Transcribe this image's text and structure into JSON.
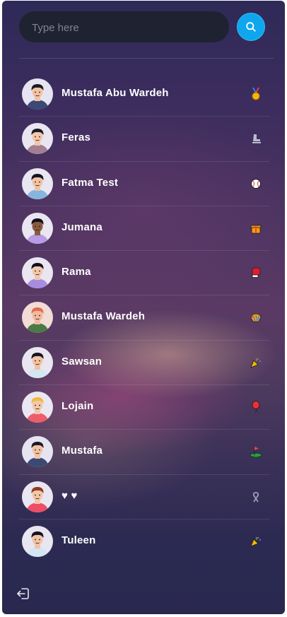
{
  "search": {
    "placeholder": "Type here",
    "button_icon": "search-icon"
  },
  "contacts": [
    {
      "name": "Mustafa Abu Wardeh",
      "avatar_bg": "#e7e4f2",
      "skin": "#f2c3a3",
      "hair": "#1c1a24",
      "shirt": "#3b4a74",
      "badge_icon": "medal-icon"
    },
    {
      "name": "Feras",
      "avatar_bg": "#e9e6f1",
      "skin": "#f3c6a8",
      "hair": "#1c1a24",
      "shirt": "#a47f91",
      "badge_icon": "ice-skate-icon"
    },
    {
      "name": "Fatma Test",
      "avatar_bg": "#e9e6f1",
      "skin": "#f1c3a3",
      "hair": "#151320",
      "shirt": "#86b5e0",
      "badge_icon": "baseball-icon"
    },
    {
      "name": "Jumana",
      "avatar_bg": "#e9e6f1",
      "skin": "#8a5a3e",
      "hair": "#111018",
      "shirt": "#b89ae6",
      "badge_icon": "gift-icon"
    },
    {
      "name": "Rama",
      "avatar_bg": "#e9e6f1",
      "skin": "#f2c8ad",
      "hair": "#111018",
      "shirt": "#a98be0",
      "badge_icon": "boxing-glove-icon"
    },
    {
      "name": "Mustafa Wardeh",
      "avatar_bg": "#f1dcd6",
      "skin": "#f2b9a0",
      "hair": "#e46b4c",
      "shirt": "#4b7a45",
      "badge_icon": "pinata-icon"
    },
    {
      "name": "Sawsan",
      "avatar_bg": "#e9e6f1",
      "skin": "#f2c3a3",
      "hair": "#151320",
      "shirt": "#d4e6f2",
      "badge_icon": "party-popper-icon"
    },
    {
      "name": "Lojain",
      "avatar_bg": "#eae7f2",
      "skin": "#f3c8aa",
      "hair": "#f0b93a",
      "shirt": "#ee5d6b",
      "badge_icon": "balloon-icon"
    },
    {
      "name": "Mustafa",
      "avatar_bg": "#e7e4f2",
      "skin": "#f2c3a3",
      "hair": "#1c1a24",
      "shirt": "#3b4a74",
      "badge_icon": "golf-flag-icon"
    },
    {
      "name": "♥ ♥",
      "avatar_bg": "#e9e6f1",
      "skin": "#f3c6a8",
      "hair": "#8a3b22",
      "shirt": "#ee4d67",
      "badge_icon": "ribbon-icon"
    },
    {
      "name": "Tuleen",
      "avatar_bg": "#e9e6f1",
      "skin": "#f2c3a3",
      "hair": "#151320",
      "shirt": "#d4e6f2",
      "badge_icon": "party-popper-icon"
    }
  ],
  "footer": {
    "logout_icon": "logout-icon"
  },
  "colors": {
    "accent": "#0ea6ec",
    "search_bg": "#1f2230",
    "text": "#ffffff"
  }
}
